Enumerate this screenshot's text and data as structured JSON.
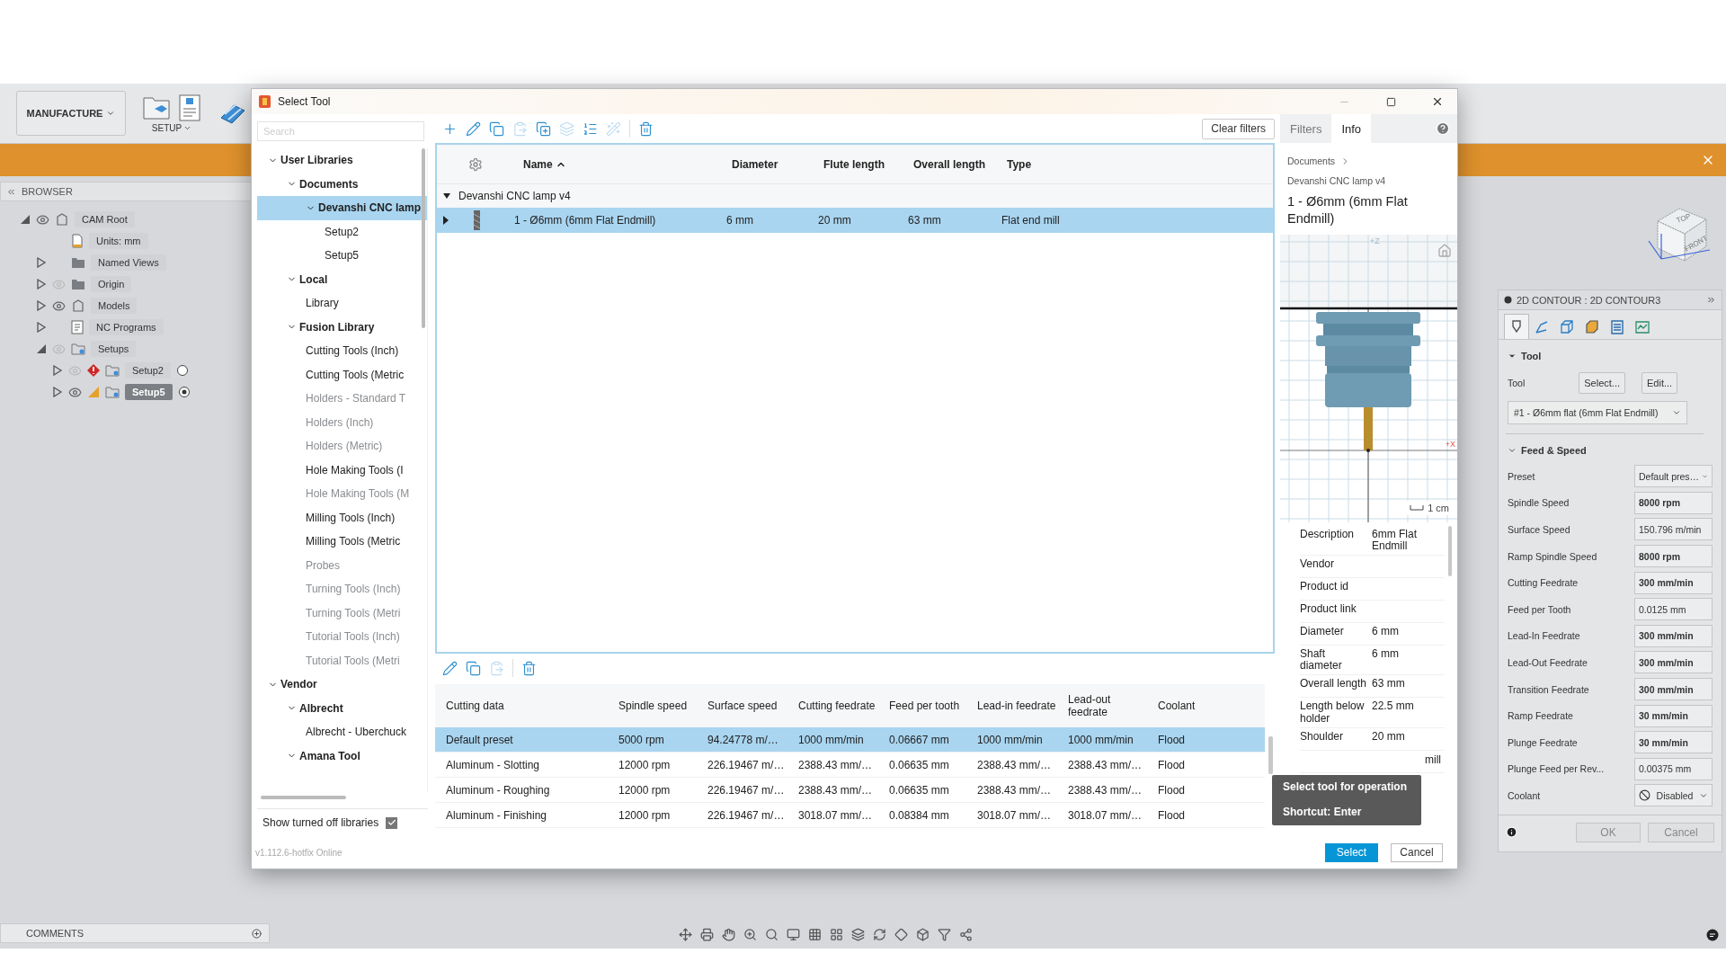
{
  "app": {
    "workspace": "MANUFACTURE",
    "setup_label": "SETUP",
    "browser": {
      "title": "BROWSER",
      "items": [
        {
          "label": "CAM Root",
          "kind": "component",
          "visible": true,
          "expanded": true,
          "selected": false,
          "children": [
            {
              "label": "Units: mm",
              "kind": "units",
              "selected": false
            },
            {
              "label": "Named Views",
              "kind": "folder",
              "expanded": false,
              "selected": false
            },
            {
              "label": "Origin",
              "kind": "folder",
              "visible": false,
              "expanded": false,
              "selected": false
            },
            {
              "label": "Models",
              "kind": "component",
              "visible": true,
              "expanded": false,
              "selected": false
            },
            {
              "label": "NC Programs",
              "kind": "nc",
              "expanded": false,
              "selected": false
            },
            {
              "label": "Setups",
              "kind": "setup",
              "visible": false,
              "expanded": true,
              "selected": false,
              "children": [
                {
                  "label": "Setup2",
                  "kind": "setup",
                  "visible": false,
                  "expanded": false,
                  "error": true,
                  "caution": false,
                  "active": false,
                  "selected": false
                },
                {
                  "label": "Setup5",
                  "kind": "setup",
                  "visible": true,
                  "expanded": false,
                  "error": false,
                  "caution": true,
                  "active": true,
                  "selected": true
                }
              ]
            }
          ]
        }
      ]
    },
    "comments": "COMMENTS",
    "viewcube": {
      "top": "TOP",
      "front": "FRONT"
    },
    "cam_panel": {
      "title": "2D CONTOUR : 2D CONTOUR3",
      "tabs": [
        {
          "kind": "tool",
          "selected": true
        },
        {
          "kind": "geometry",
          "selected": false
        },
        {
          "kind": "heights",
          "selected": false
        },
        {
          "kind": "passes",
          "selected": false
        },
        {
          "kind": "linking",
          "selected": false
        },
        {
          "kind": "simulation",
          "selected": false
        }
      ],
      "tool_section": {
        "title": "Tool",
        "expanded": true,
        "label": "Tool",
        "select_button": "Select...",
        "edit_button": "Edit...",
        "tool": "#1 - Ø6mm flat (6mm Flat Endmill)"
      },
      "feed_section": {
        "title": "Feed & Speed",
        "expanded": true,
        "rows": [
          {
            "label": "Preset",
            "kind": "select",
            "value": "Default pres…",
            "bold": false
          },
          {
            "label": "Spindle Speed",
            "kind": "input",
            "value": "8000 rpm",
            "bold": true
          },
          {
            "label": "Surface Speed",
            "kind": "input",
            "value": "150.796 m/min",
            "bold": false
          },
          {
            "label": "Ramp Spindle Speed",
            "kind": "input",
            "value": "8000 rpm",
            "bold": true
          },
          {
            "label": "Cutting Feedrate",
            "kind": "input",
            "value": "300 mm/min",
            "bold": true
          },
          {
            "label": "Feed per Tooth",
            "kind": "input",
            "value": "0.0125 mm",
            "bold": false
          },
          {
            "label": "Lead-In Feedrate",
            "kind": "input",
            "value": "300 mm/min",
            "bold": true
          },
          {
            "label": "Lead-Out Feedrate",
            "kind": "input",
            "value": "300 mm/min",
            "bold": true
          },
          {
            "label": "Transition Feedrate",
            "kind": "input",
            "value": "300 mm/min",
            "bold": true
          },
          {
            "label": "Ramp Feedrate",
            "kind": "input",
            "value": "30 mm/min",
            "bold": true
          },
          {
            "label": "Plunge Feedrate",
            "kind": "input",
            "value": "30 mm/min",
            "bold": true
          },
          {
            "label": "Plunge Feed per Rev...",
            "kind": "input",
            "value": "0.00375 mm",
            "bold": false
          },
          {
            "label": "Coolant",
            "kind": "coolant",
            "value": "Disabled",
            "bold": false
          }
        ]
      },
      "ok": "OK",
      "cancel": "Cancel"
    }
  },
  "dialog": {
    "title": "Select Tool",
    "search": {
      "placeholder": "Search"
    },
    "libraries": [
      {
        "label": "User Libraries",
        "expanded": true,
        "selected": false,
        "children": [
          {
            "label": "Documents",
            "expanded": true,
            "selected": false,
            "children": [
              {
                "label": "Devanshi CNC lamp",
                "expanded": true,
                "selected": true,
                "children": [
                  {
                    "label": "Setup2",
                    "selected": false
                  },
                  {
                    "label": "Setup5",
                    "selected": false
                  }
                ]
              }
            ]
          },
          {
            "label": "Local",
            "expanded": true,
            "selected": false,
            "children": [
              {
                "label": "Library",
                "selected": false
              }
            ]
          },
          {
            "label": "Fusion Library",
            "expanded": true,
            "selected": false,
            "children": [
              {
                "label": "Cutting Tools (Inch)",
                "enabled": true,
                "selected": false
              },
              {
                "label": "Cutting Tools (Metric",
                "enabled": true,
                "selected": false
              },
              {
                "label": "Holders - Standard T",
                "enabled": false,
                "selected": false
              },
              {
                "label": "Holders (Inch)",
                "enabled": false,
                "selected": false
              },
              {
                "label": "Holders (Metric)",
                "enabled": false,
                "selected": false
              },
              {
                "label": "Hole Making Tools (I",
                "enabled": true,
                "selected": false
              },
              {
                "label": "Hole Making Tools (M",
                "enabled": false,
                "selected": false
              },
              {
                "label": "Milling Tools (Inch)",
                "enabled": true,
                "selected": false
              },
              {
                "label": "Milling Tools (Metric",
                "enabled": true,
                "selected": false
              },
              {
                "label": "Probes",
                "enabled": false,
                "selected": false
              },
              {
                "label": "Turning Tools (Inch)",
                "enabled": false,
                "selected": false
              },
              {
                "label": "Turning Tools (Metri",
                "enabled": false,
                "selected": false
              },
              {
                "label": "Tutorial Tools (Inch)",
                "enabled": false,
                "selected": false
              },
              {
                "label": "Tutorial Tools (Metri",
                "enabled": false,
                "selected": false
              }
            ]
          }
        ]
      },
      {
        "label": "Vendor",
        "expanded": true,
        "selected": false,
        "children": [
          {
            "label": "Albrecht",
            "expanded": true,
            "selected": false,
            "children": [
              {
                "label": "Albrecht - Uberchuck",
                "selected": false
              }
            ]
          },
          {
            "label": "Amana Tool",
            "expanded": true,
            "selected": false
          }
        ]
      }
    ],
    "show_off": {
      "label": "Show turned off libraries",
      "checked": true
    },
    "version": "v1.112.6-hotfix Online",
    "toolbar": [
      {
        "kind": "add",
        "disabled": false
      },
      {
        "kind": "edit",
        "disabled": false
      },
      {
        "kind": "copy",
        "disabled": false
      },
      {
        "kind": "paste",
        "disabled": true
      },
      {
        "kind": "duplicate",
        "disabled": false
      },
      {
        "kind": "holder",
        "disabled": true
      },
      {
        "kind": "renumber",
        "disabled": false
      },
      {
        "kind": "wand",
        "disabled": true
      },
      {
        "kind": "delete",
        "disabled": false
      }
    ],
    "clear_filters": "Clear filters",
    "tools": {
      "columns": [
        {
          "label": "Name",
          "sorted": true
        },
        {
          "label": "Diameter",
          "sorted": false
        },
        {
          "label": "Flute length",
          "sorted": false
        },
        {
          "label": "Overall length",
          "sorted": false
        },
        {
          "label": "Type",
          "sorted": false
        }
      ],
      "groups": [
        {
          "name": "Devanshi CNC lamp v4",
          "expanded": true,
          "rows": [
            {
              "cells": [
                "1 - Ø6mm (6mm Flat Endmill)",
                "6 mm",
                "20 mm",
                "63 mm",
                "Flat end mill"
              ],
              "expanded": false,
              "selected": true
            }
          ]
        }
      ]
    },
    "preset_toolbar": [
      {
        "kind": "edit",
        "disabled": false
      },
      {
        "kind": "copy",
        "disabled": false
      },
      {
        "kind": "paste",
        "disabled": true
      },
      {
        "kind": "delete",
        "disabled": false
      }
    ],
    "presets": {
      "columns": [
        "Cutting data",
        "Spindle speed",
        "Surface speed",
        "Cutting feedrate",
        "Feed per tooth",
        "Lead-in feedrate",
        "Lead-out feedrate",
        "Coolant"
      ],
      "rows": [
        {
          "cells": [
            "Default preset",
            "5000 rpm",
            "94.24778 m/…",
            "1000 mm/min",
            "0.06667 mm",
            "1000 mm/min",
            "1000 mm/min",
            "Flood"
          ],
          "selected": true
        },
        {
          "cells": [
            "Aluminum - Slotting",
            "12000 rpm",
            "226.19467 m/…",
            "2388.43 mm/…",
            "0.06635 mm",
            "2388.43 mm/…",
            "2388.43 mm/…",
            "Flood"
          ],
          "selected": false
        },
        {
          "cells": [
            "Aluminum - Roughing",
            "12000 rpm",
            "226.19467 m/…",
            "2388.43 mm/…",
            "0.06635 mm",
            "2388.43 mm/…",
            "2388.43 mm/…",
            "Flood"
          ],
          "selected": false
        },
        {
          "cells": [
            "Aluminum - Finishing",
            "12000 rpm",
            "226.19467 m/…",
            "3018.07 mm/…",
            "0.08384 mm",
            "3018.07 mm/…",
            "3018.07 mm/…",
            "Flood"
          ],
          "selected": false
        }
      ]
    },
    "info_tabs": [
      {
        "label": "Filters",
        "selected": false
      },
      {
        "label": "Info",
        "selected": true
      }
    ],
    "breadcrumb": "Documents",
    "library": "Devanshi CNC lamp v4",
    "tool_title": "1 - Ø6mm (6mm Flat Endmill)",
    "preview": {
      "z_label": "+Z",
      "x_label": "+X",
      "scale": "1 cm"
    },
    "properties": [
      {
        "label": "Description",
        "value": "6mm Flat Endmill"
      },
      {
        "label": "Vendor"
      },
      {
        "label": "Product id"
      },
      {
        "label": "Product link"
      },
      {
        "label": "Diameter",
        "value": "6 mm"
      },
      {
        "label": "Shaft diameter",
        "value": "6 mm"
      },
      {
        "label": "Overall length",
        "value": "63 mm"
      },
      {
        "label": "Length below holder",
        "value": "22.5 mm"
      },
      {
        "label": "Shoulder",
        "value": "20 mm"
      },
      {
        "value": "mill"
      }
    ],
    "tooltip": {
      "title": "Select tool for operation",
      "shortcut": "Shortcut: Enter"
    },
    "select_button": "Select",
    "cancel_button": "Cancel"
  }
}
